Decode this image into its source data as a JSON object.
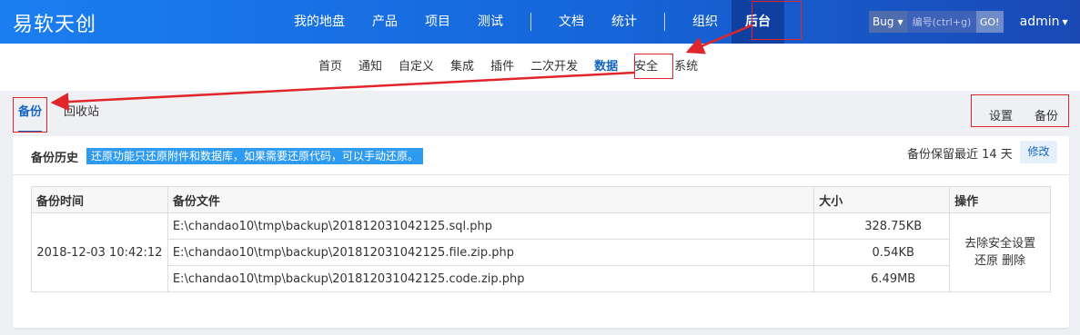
{
  "app": {
    "logo": "易软天创"
  },
  "main_nav": {
    "items": [
      "我的地盘",
      "产品",
      "项目",
      "测试",
      "文档",
      "统计",
      "组织",
      "后台"
    ],
    "active": "后台"
  },
  "search": {
    "type_label": "Bug",
    "placeholder": "编号(ctrl+g)",
    "go_label": "GO!"
  },
  "user": {
    "name": "admin"
  },
  "sub_nav": {
    "items": [
      "首页",
      "通知",
      "自定义",
      "集成",
      "插件",
      "二次开发",
      "数据",
      "安全",
      "系统"
    ],
    "active": "数据"
  },
  "tabs": {
    "backup": "备份",
    "recycle": "回收站",
    "settings": "设置",
    "backup_action": "备份"
  },
  "panel": {
    "title": "备份历史",
    "hint": "还原功能只还原附件和数据库，如果需要还原代码，可以手动还原。",
    "keep_text": "备份保留最近 14 天",
    "edit_label": "修改"
  },
  "table": {
    "headers": [
      "备份时间",
      "备份文件",
      "大小",
      "操作"
    ],
    "time": "2018-12-03 10:42:12",
    "files": [
      {
        "path": "E:\\chandao10\\tmp\\backup\\201812031042125.sql.php",
        "size": "328.75KB"
      },
      {
        "path": "E:\\chandao10\\tmp\\backup\\201812031042125.file.zip.php",
        "size": "0.54KB"
      },
      {
        "path": "E:\\chandao10\\tmp\\backup\\201812031042125.code.zip.php",
        "size": "6.49MB"
      }
    ],
    "ops": {
      "remove_security": "去除安全设置",
      "restore": "还原",
      "delete": "删除"
    }
  },
  "colors": {
    "annotation": "#e0262b",
    "accent": "#1565c0",
    "topbar": "#1666da"
  }
}
